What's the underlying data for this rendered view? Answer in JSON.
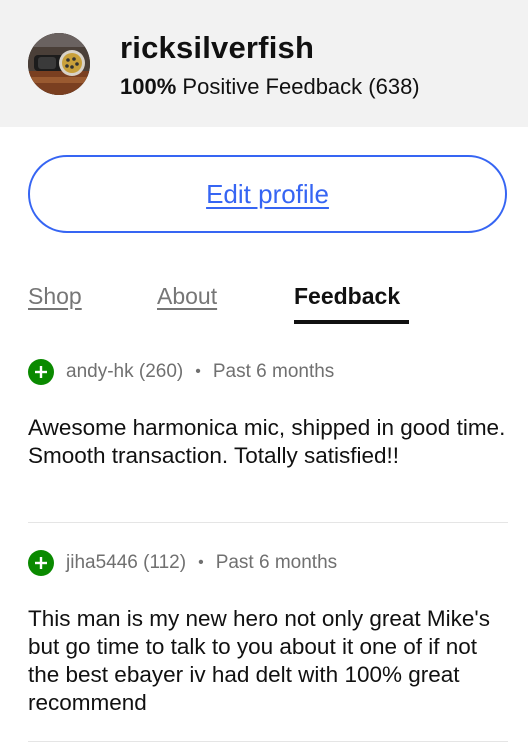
{
  "header": {
    "seller_name": "ricksilverfish",
    "feedback_percent": "100%",
    "feedback_label": "Positive Feedback (638)"
  },
  "actions": {
    "edit_profile_label": "Edit profile"
  },
  "tabs": [
    {
      "label": "Shop",
      "active": false
    },
    {
      "label": "About",
      "active": false
    },
    {
      "label": "Feedback",
      "active": true
    }
  ],
  "feedback": [
    {
      "user": "andy-hk (260)",
      "separator": "•",
      "period": "Past 6 months",
      "text": "Awesome harmonica mic, shipped in good time.  Smooth transaction.  Totally satisfied!!"
    },
    {
      "user": "jiha5446 (112)",
      "separator": "•",
      "period": "Past 6 months",
      "text": "This man is my new hero not only great Mike's but go time to talk to you about it one of if not the best ebayer iv had delt with 100% great recommend"
    }
  ],
  "colors": {
    "accent": "#3665f3",
    "positive": "#0a8a00",
    "header_bg": "#f2f2f2"
  }
}
